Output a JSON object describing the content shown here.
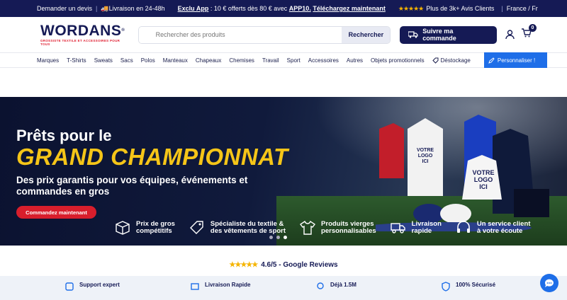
{
  "topbar": {
    "quote": "Demander un devis",
    "delivery": "Livraison en 24-48h",
    "app_label": "Exclu App",
    "app_text_1": ": 10 € offerts dès 80 € avec",
    "app_code": "APP10.",
    "app_text_2": "Téléchargez maintenant",
    "stars": "★★★★★",
    "reviews": "Plus de 3k+ Avis Clients",
    "locale": "France / Fr"
  },
  "header": {
    "logo": "WORDANS",
    "tagline": "GROSSISTE TEXTILE ET ACCESSOIRES POUR TOUS",
    "search_placeholder": "Rechercher des produits",
    "search_button": "Rechercher",
    "track_button": "Suivre ma commande",
    "cart_count": "0"
  },
  "nav": {
    "items": [
      "Marques",
      "T-Shirts",
      "Sweats",
      "Sacs",
      "Polos",
      "Manteaux",
      "Chapeaux",
      "Chemises",
      "Travail",
      "Sport",
      "Accessoires",
      "Autres",
      "Objets promotionnels"
    ],
    "destock": "Déstockage",
    "customize": "Personnaliser !"
  },
  "hero": {
    "line1": "Prêts pour le",
    "line2": "GRAND CHAMPIONNAT",
    "subtitle": "Des prix garantis pour vos équipes, événements et commandes en gros",
    "cta": "Commandez maintenant",
    "shirt_text": "VOTRE LOGO ICI",
    "features": [
      {
        "l1": "Prix de gros",
        "l2": "compétitifs"
      },
      {
        "l1": "Spécialiste du textile &",
        "l2": "des vêtements de sport"
      },
      {
        "l1": "Produits vierges",
        "l2": "personnalisables"
      },
      {
        "l1": "Livraison",
        "l2": "rapide"
      },
      {
        "l1": "Un service client",
        "l2": "à votre écoute"
      }
    ]
  },
  "reviews": {
    "stars": "★★★★★",
    "text": "4.6/5 - Google Reviews"
  },
  "bottom": {
    "items": [
      "Support expert",
      "Livraison Rapide",
      "Déjà 1.5M",
      "100% Sécurisé"
    ]
  },
  "colors": {
    "navy": "#151a55",
    "accent_blue": "#1e6ee8",
    "red": "#d81e2c",
    "gold": "#f5c518"
  }
}
